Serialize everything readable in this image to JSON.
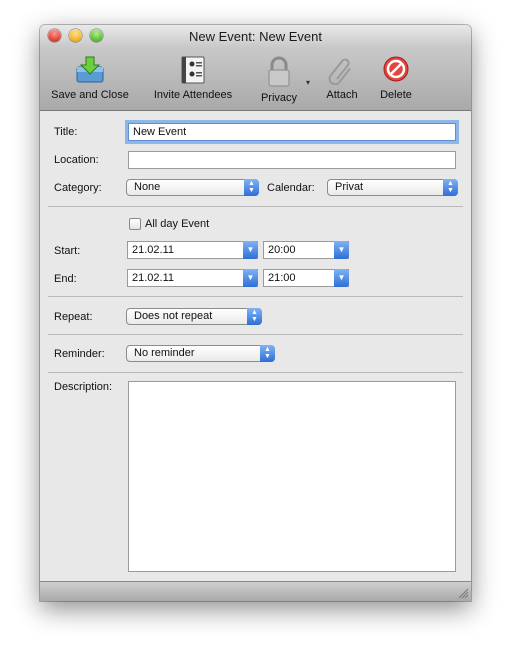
{
  "window": {
    "title": "New Event: New Event"
  },
  "toolbar": {
    "save_close": "Save and Close",
    "invite": "Invite Attendees",
    "privacy": "Privacy",
    "attach": "Attach",
    "delete": "Delete"
  },
  "form": {
    "title_label": "Title:",
    "title_value": "New Event",
    "location_label": "Location:",
    "location_value": "",
    "category_label": "Category:",
    "category_value": "None",
    "calendar_label": "Calendar:",
    "calendar_value": "Privat",
    "all_day_label": "All day Event",
    "all_day_checked": false,
    "start_label": "Start:",
    "start_date": "21.02.11",
    "start_time": "20:00",
    "end_label": "End:",
    "end_date": "21.02.11",
    "end_time": "21:00",
    "repeat_label": "Repeat:",
    "repeat_value": "Does not repeat",
    "reminder_label": "Reminder:",
    "reminder_value": "No reminder",
    "description_label": "Description:",
    "description_value": ""
  },
  "colors": {
    "accent_blue": "#2f6fd6",
    "focus_ring": "#8fb6e8",
    "delete_red": "#d9302a"
  }
}
